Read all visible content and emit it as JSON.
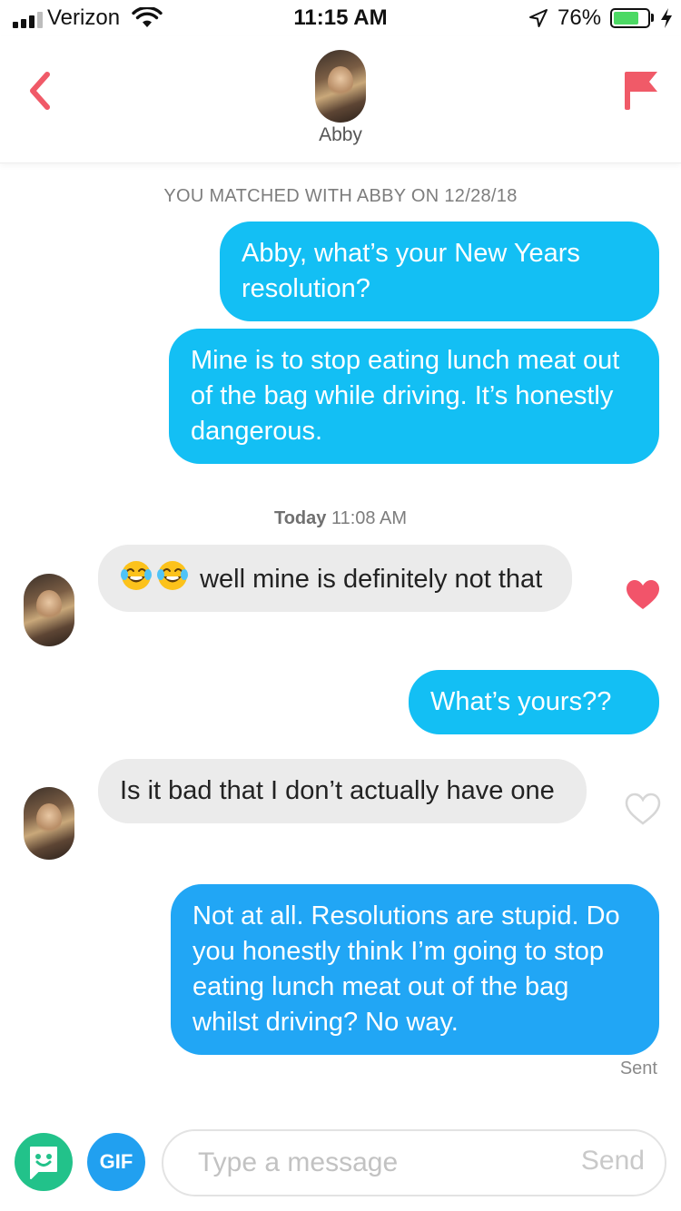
{
  "status_bar": {
    "carrier": "Verizon",
    "time": "11:15 AM",
    "battery_percent": "76%",
    "battery_level": 0.76
  },
  "header": {
    "name": "Abby",
    "flag_color": "#f05a68",
    "back_color": "#f05a68"
  },
  "chat": {
    "matched_text": "YOU MATCHED WITH ABBY ON 12/28/18",
    "timestamp_day": "Today",
    "timestamp_time": "11:08 AM",
    "messages": [
      {
        "from": "me",
        "text": "Abby, what’s your New Years resolution?"
      },
      {
        "from": "me",
        "text": "Mine is to stop eating lunch meat out of the bag while driving. It’s honestly dangerous."
      },
      {
        "from": "abby",
        "text": "well mine is definitely not that",
        "emoji": [
          "face-with-tears-of-joy",
          "face-with-tears-of-joy"
        ],
        "liked": true
      },
      {
        "from": "me",
        "text": "What’s yours??"
      },
      {
        "from": "abby",
        "text": "Is it bad that I don’t actually have one",
        "liked": false
      },
      {
        "from": "me",
        "text": "Not at all. Resolutions are stupid. Do you honestly think I’m going to stop eating lunch meat out of the bag whilst driving? No way."
      }
    ],
    "sent_label": "Sent"
  },
  "composer": {
    "gif_label": "GIF",
    "placeholder": "Type a message",
    "send_label": "Send"
  },
  "colors": {
    "outgoing": "#13bff4",
    "outgoing_latest": "#21a6f5",
    "incoming": "#ebebeb",
    "like_heart": "#f2546a",
    "sticker_button": "#22c28a",
    "gif_button": "#21a0f0"
  }
}
